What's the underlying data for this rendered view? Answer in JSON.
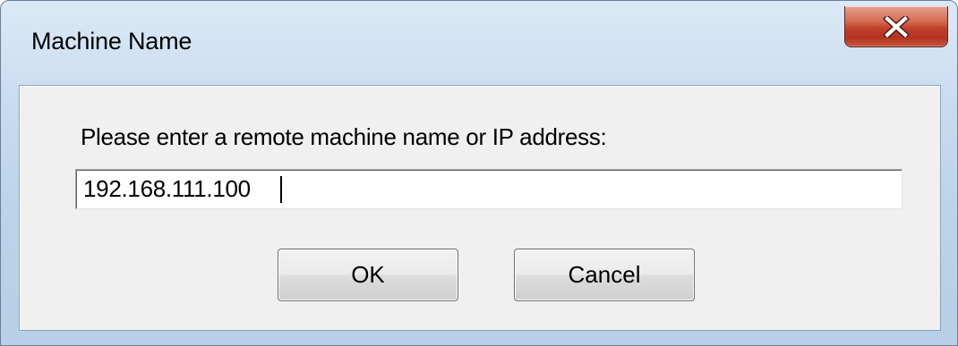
{
  "window": {
    "title": "Machine Name",
    "close_icon": "close-x-icon"
  },
  "dialog": {
    "prompt": "Please enter a remote machine name or IP address:",
    "address_value": "192.168.111.100",
    "ok_label": "OK",
    "cancel_label": "Cancel"
  },
  "colors": {
    "close_button": "#c7432c",
    "client_background": "#f0f0f0",
    "frame": "#bcd3ea"
  }
}
